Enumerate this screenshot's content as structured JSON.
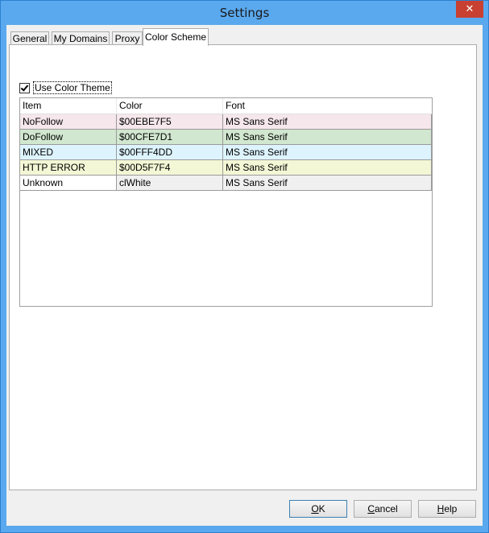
{
  "window": {
    "title": "Settings",
    "close_glyph": "✕"
  },
  "tabs": [
    {
      "label": "General"
    },
    {
      "label": "My Domains"
    },
    {
      "label": "Proxy"
    },
    {
      "label": "Color Scheme",
      "active": true
    }
  ],
  "use_color_theme": {
    "label": "Use Color Theme",
    "checked": true
  },
  "grid": {
    "headers": [
      "Item",
      "Color",
      "Font"
    ],
    "rows": [
      {
        "item": "NoFollow",
        "color": "$00EBE7F5",
        "font": "MS Sans Serif",
        "bg": "#F5E7EB"
      },
      {
        "item": "DoFollow",
        "color": "$00CFE7D1",
        "font": "MS Sans Serif",
        "bg": "#D1E7CF"
      },
      {
        "item": "MIXED",
        "color": "$00FFF4DD",
        "font": "MS Sans Serif",
        "bg": "#DDF4FF"
      },
      {
        "item": "HTTP ERROR",
        "color": "$00D5F7F4",
        "font": "MS Sans Serif",
        "bg": "#F4F7D5"
      },
      {
        "item": "Unknown",
        "color": "clWhite",
        "font": "MS Sans Serif",
        "bg": "#FFFFFF",
        "rest_bg": "#F0F0F0"
      }
    ]
  },
  "buttons": {
    "ok": {
      "label": "OK",
      "accel": "O",
      "rest": "K"
    },
    "cancel": {
      "label": "Cancel",
      "accel": "C",
      "rest": "ancel"
    },
    "help": {
      "label": "Help",
      "accel": "H",
      "rest": "elp"
    }
  },
  "colors": {
    "title_bar": "#5AA9EE",
    "close_button": "#C84031",
    "dialog_bg": "#F0F0F0"
  }
}
